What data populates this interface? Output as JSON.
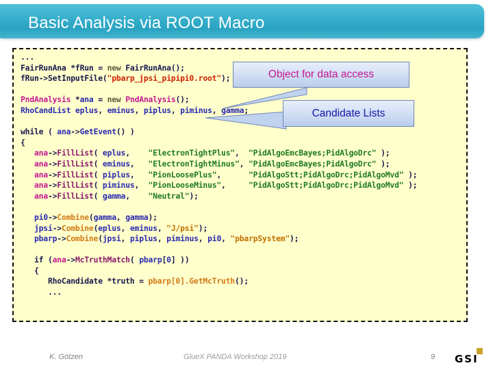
{
  "slide": {
    "title": "Basic Analysis via ROOT Macro",
    "header_color": "#35aecb",
    "code_bg_color": "#ffffcc"
  },
  "code": {
    "language": "cpp",
    "lines": [
      "...",
      "FairRunAna *fRun = new FairRunAna();",
      "fRun->SetInputFile(\"pbarp_jpsi_pipipi0.root\");",
      "",
      "PndAnalysis *ana = new PndAnalysis();",
      "RhoCandList eplus, eminus, piplus, piminus, gamma;",
      "",
      "while ( ana->GetEvent() )",
      "{",
      "   ana->FillList( eplus,    \"ElectronTightPlus\",  \"PidAlgoEmcBayes;PidAlgoDrc\" );",
      "   ana->FillList( eminus,   \"ElectronTightMinus\", \"PidAlgoEmcBayes;PidAlgoDrc\" );",
      "   ana->FillList( piplus,   \"PionLoosePlus\",      \"PidAlgoStt;PidAlgoDrc;PidAlgoMvd\" );",
      "   ana->FillList( piminus,  \"PionLooseMinus\",     \"PidAlgoStt;PidAlgoDrc;PidAlgoMvd\" );",
      "   ana->FillList( gamma,    \"Neutral\");",
      "",
      "   pi0->Combine(gamma, gamma);",
      "   jpsi->Combine(eplus, eminus, \"J/psi\");",
      "   pbarp->Combine(jpsi, piplus, piminus, pi0, \"pbarpSystem\");",
      "",
      "   if (ana->McTruthMatch( pbarp[0] ))",
      "   {",
      "      RhoCandidate *truth = pbarp[0].GetMcTruth();",
      "      ..."
    ]
  },
  "callouts": [
    {
      "id": "data-access",
      "label": "Object for data access",
      "color": "#c2188f"
    },
    {
      "id": "candidate-lists",
      "label": "Candidate Lists",
      "color": "#1515a8"
    }
  ],
  "footer": {
    "author": "K. Götzen",
    "event": "GlueX PANDA Workshop 2019",
    "page_number": "9",
    "logo_text": "GSI"
  }
}
